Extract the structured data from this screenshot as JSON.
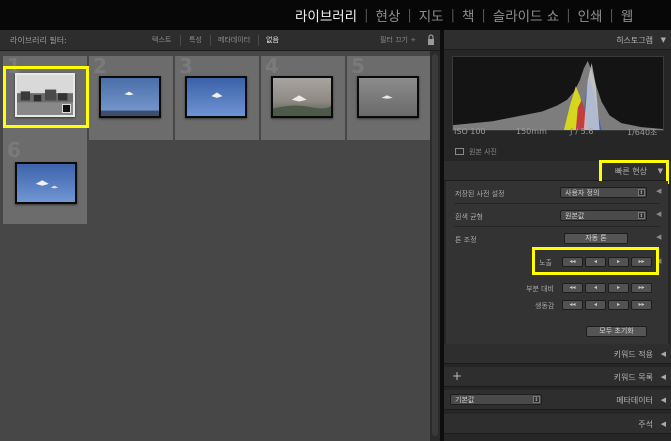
{
  "modules": {
    "items": [
      {
        "label": "라이브러리",
        "active": true
      },
      {
        "label": "현상",
        "active": false
      },
      {
        "label": "지도",
        "active": false
      },
      {
        "label": "책",
        "active": false
      },
      {
        "label": "슬라이드 쇼",
        "active": false
      },
      {
        "label": "인쇄",
        "active": false
      },
      {
        "label": "웹",
        "active": false
      }
    ],
    "separator": "|"
  },
  "filter_bar": {
    "label": "라이브러리 필터:",
    "text": "텍스트",
    "attribute": "특성",
    "metadata": "메타데이터",
    "none": "없음",
    "filters_off": "필터 끄기 ÷"
  },
  "grid": {
    "cells": [
      {
        "number": "1",
        "selected": true
      },
      {
        "number": "2",
        "selected": false
      },
      {
        "number": "3",
        "selected": false
      },
      {
        "number": "4",
        "selected": false
      },
      {
        "number": "5",
        "selected": false
      },
      {
        "number": "6",
        "selected": false
      }
    ]
  },
  "histogram": {
    "title": "히스토그램",
    "iso": "ISO 100",
    "focal": "150mm",
    "aperture": "ƒ / 5.6",
    "shutter": "1/640초",
    "original_photo": "원본 사진"
  },
  "quick_develop": {
    "title": "빠른 현상",
    "saved_preset_label": "저장된 사전 설정",
    "saved_preset_value": "사용자 정의",
    "white_balance_label": "흰색 균형",
    "white_balance_value": "원본값",
    "tone_label": "톤 조정",
    "auto_tone": "자동 톤",
    "exposure_label": "노출",
    "clarity_label": "부분 대비",
    "vibrance_label": "생동감",
    "step_labels": [
      "◂◂",
      "◂",
      "▸",
      "▸▸"
    ],
    "reset_all": "모두 초기화"
  },
  "panels": {
    "keywording": "키워드 적용",
    "keyword_list": "키워드 목록",
    "keyword_plus": "+",
    "metadata": "메타데이터",
    "metadata_preset": "기본값",
    "comments": "주석"
  },
  "colors": {
    "highlight": "#ffff00",
    "accent_text": "#f2f2f2"
  }
}
